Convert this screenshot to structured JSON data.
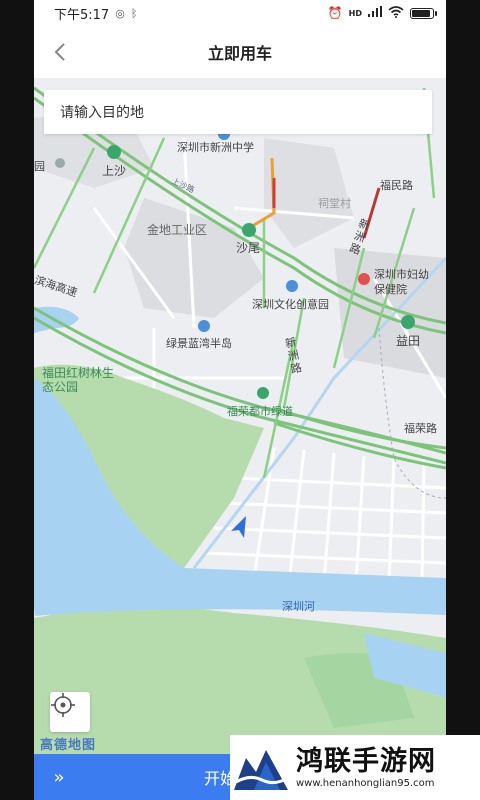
{
  "status_bar": {
    "time": "下午5:17",
    "icons": [
      "alarm-icon",
      "hd-icon",
      "signal-icon",
      "wifi-icon",
      "battery-icon"
    ]
  },
  "nav": {
    "title": "立即用车",
    "back_icon": "chevron-left-icon"
  },
  "search": {
    "placeholder": "请输入目的地"
  },
  "map": {
    "labels": {
      "xinzhou_middle_school": "深圳市新洲中学",
      "shangsha": "上沙",
      "park_left": "园",
      "jindi_industrial": "金地工业区",
      "shawei": "沙尾",
      "xiangtang_village": "祠堂村",
      "xinzhou_road_top": "新洲路",
      "fumin_road": "福民路",
      "maternal_child": "深圳市妇幼保健院",
      "culture_park": "深圳文化创意园",
      "lujing_bay": "绿景蓝湾半岛",
      "yitian": "益田",
      "expressway": "滨海高速",
      "mangrove_park": "福田红树林生态公园",
      "xinzhou_road_mid": "新洲路",
      "furong_greenway": "福荣都市绿道",
      "furong_road": "福荣路",
      "shenzhen_river": "深圳河",
      "shangsha_road_small": "上沙路"
    },
    "amap_logo": "高德地图"
  },
  "bottom_bar": {
    "slide_icon": "»",
    "start_label": "开始"
  },
  "watermark": {
    "title": "鸿联手游网",
    "url": "www.henanhonglian95.com"
  }
}
